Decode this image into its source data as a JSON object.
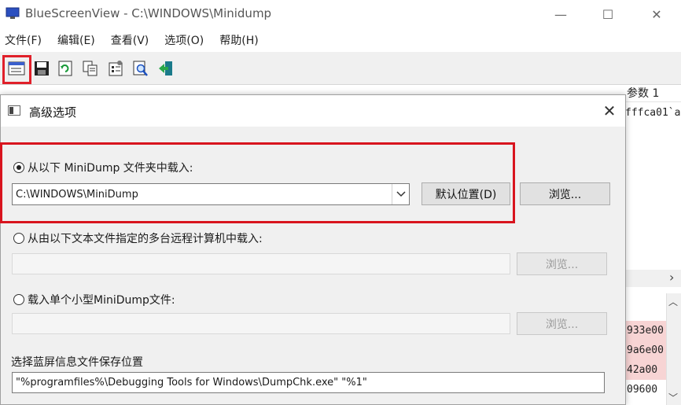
{
  "window": {
    "title": "BlueScreenView  -  C:\\WINDOWS\\Minidump",
    "minimize": "—",
    "maximize": "☐",
    "close": "✕"
  },
  "menu": [
    "文件(F)",
    "编辑(E)",
    "查看(V)",
    "选项(O)",
    "帮助(H)"
  ],
  "toolbar": {
    "icons": [
      "advanced-options-icon",
      "save-icon",
      "refresh-icon",
      "copy-icon",
      "properties-icon",
      "find-icon",
      "exit-icon"
    ]
  },
  "background": {
    "column_partial": "参数 1",
    "first_row_partial": "fffca01`a",
    "rows": [
      "933e00",
      "9a6e00",
      "42a00",
      "09600"
    ],
    "row_colors": [
      "#f7d4d4",
      "#f7d4d4",
      "#f7d4d4",
      "#ffffff"
    ],
    "hscroll_arrow": "›",
    "vscroll_up": "︿",
    "vscroll_down": "﹀"
  },
  "dialog": {
    "title": "高级选项",
    "close": "✕",
    "option1": {
      "label": "从以下 MiniDump 文件夹中载入:",
      "checked": true,
      "value": "C:\\WINDOWS\\MiniDump",
      "default_button": "默认位置(D)",
      "browse_button": "浏览..."
    },
    "option2": {
      "label": "从由以下文本文件指定的多台远程计算机中载入:",
      "checked": false,
      "browse_button": "浏览..."
    },
    "option3": {
      "label": "载入单个小型MiniDump文件:",
      "checked": false,
      "browse_button": "浏览..."
    },
    "save_section": {
      "label": "选择蓝屏信息文件保存位置",
      "value": "\"%programfiles%\\Debugging Tools for Windows\\DumpChk.exe\" \"%1\""
    }
  },
  "colors": {
    "highlight": "#d8141e",
    "dialog_bg": "#f0f0f0"
  }
}
